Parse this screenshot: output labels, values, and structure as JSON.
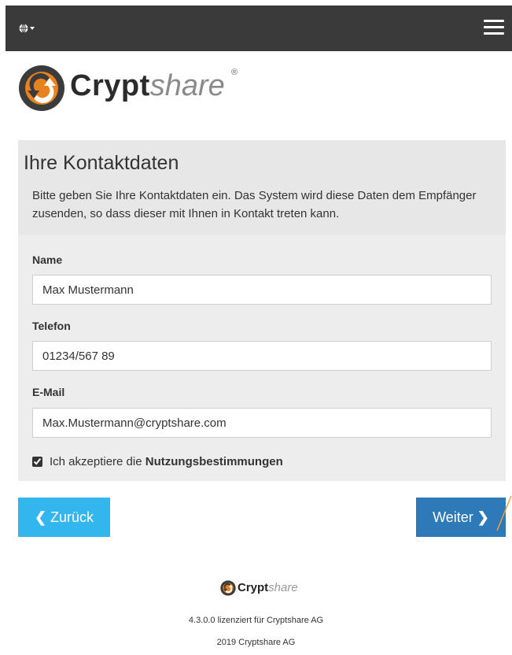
{
  "navbar": {
    "language_icon": "globe-icon",
    "menu_icon": "hamburger-menu-icon"
  },
  "logo": {
    "bold": "Crypt",
    "light": "share",
    "registered": "®"
  },
  "panel": {
    "title": "Ihre Kontaktdaten",
    "description": "Bitte geben Sie Ihre Kontaktdaten ein. Das System wird diese Daten dem Empfänger zusenden, so dass dieser mit Ihnen in Kontakt treten kann."
  },
  "form": {
    "name_label": "Name",
    "name_value": "Max Mustermann",
    "phone_label": "Telefon",
    "phone_value": "01234/567 89",
    "email_label": "E-Mail",
    "email_value": "Max.Mustermann@cryptshare.com",
    "terms_prefix": "Ich akzeptiere die ",
    "terms_link": "Nutzungsbestimmungen",
    "terms_checked": true
  },
  "buttons": {
    "back": "Zurück",
    "next": "Weiter",
    "back_icon": "chevron-left-icon",
    "next_icon": "chevron-right-icon"
  },
  "footer": {
    "logo_bold": "Crypt",
    "logo_light": "share",
    "version": "4.3.0.0 lizenziert für Cryptshare AG",
    "copyright": "2019 Cryptshare AG"
  },
  "colors": {
    "navbar": "#3a3a3a",
    "back_button": "#33b5ee",
    "next_button": "#2e7ab8",
    "logo_orange": "#e8821e"
  }
}
